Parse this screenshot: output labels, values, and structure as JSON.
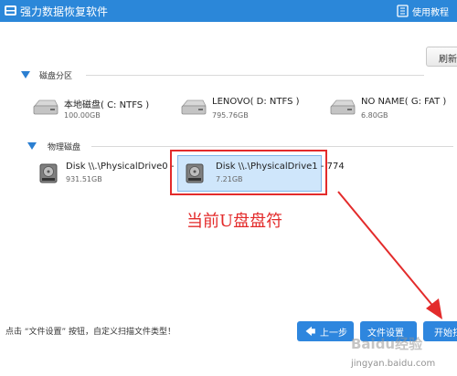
{
  "window": {
    "title": "强力数据恢复软件",
    "help_label": "使用教程"
  },
  "toolbar": {
    "refresh_label": "刷新"
  },
  "partitions": {
    "label": "磁盘分区",
    "items": [
      {
        "name": "本地磁盘( C: NTFS )",
        "size": "100.00GB"
      },
      {
        "name": "LENOVO( D: NTFS )",
        "size": "795.76GB"
      },
      {
        "name": "NO NAME( G: FAT )",
        "size": "6.80GB"
      }
    ]
  },
  "physical": {
    "label": "物理磁盘",
    "items": [
      {
        "name": "Disk \\\\.\\PhysicalDrive0 - 100",
        "size": "931.51GB",
        "selected": false
      },
      {
        "name": "Disk \\\\.\\PhysicalDrive1 - 774",
        "size": "7.21GB",
        "selected": true
      }
    ]
  },
  "annotation": {
    "text": "当前U盘盘符",
    "color": "#e32b2b"
  },
  "footer": {
    "hint": "点击 “文件设置” 按钮，自定义扫描文件类型！",
    "back_label": "上一步",
    "settings_label": "文件设置",
    "start_label": "开始扫描"
  },
  "watermark": {
    "logo": "Baidu经验",
    "url": "jingyan.baidu.com"
  },
  "colors": {
    "titlebar": "#2b87d9",
    "button": "#2e86de",
    "selection": "#cfe6fb",
    "annotation": "#e32b2b"
  }
}
